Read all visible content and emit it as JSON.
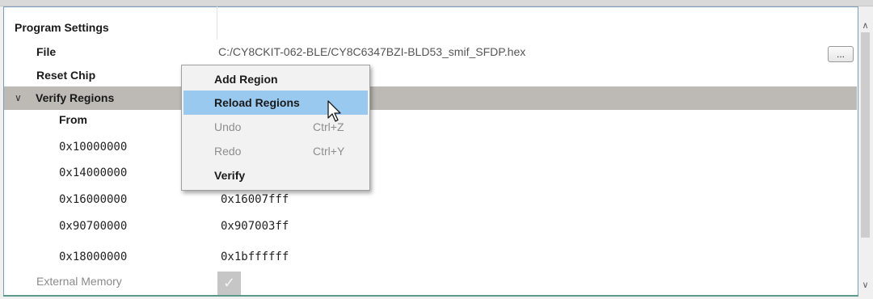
{
  "properties": {
    "program_settings": "Program Settings",
    "file_label": "File",
    "file_value": "C:/CY8CKIT-062-BLE/CY8C6347BZI-BLD53_smif_SFDP.hex",
    "browse_label": "...",
    "reset_chip": "Reset Chip",
    "verify_regions": "Verify Regions",
    "from_header": "From",
    "regions": [
      {
        "from": "0x10000000",
        "to": ""
      },
      {
        "from": "0x14000000",
        "to": ""
      },
      {
        "from": "0x16000000",
        "to": "0x16007fff"
      },
      {
        "from": "0x90700000",
        "to": "0x907003ff"
      },
      {
        "from": "0x18000000",
        "to": "0x1bffffff"
      }
    ],
    "external_memory": "External Memory"
  },
  "context_menu": {
    "items": [
      {
        "label": "Add Region",
        "shortcut": "",
        "state": "enabled"
      },
      {
        "label": "Reload Regions",
        "shortcut": "",
        "state": "highlighted"
      },
      {
        "label": "Undo",
        "shortcut": "Ctrl+Z",
        "state": "disabled"
      },
      {
        "label": "Redo",
        "shortcut": "Ctrl+Y",
        "state": "disabled"
      },
      {
        "label": "Verify",
        "shortcut": "",
        "state": "enabled"
      }
    ]
  },
  "icons": {
    "expander": "chevron-down-icon",
    "checkbox": "check-icon",
    "scroll_up": "arrow-up-icon",
    "scroll_down": "arrow-down-icon",
    "cursor": "mouse-pointer-icon"
  },
  "colors": {
    "selected_row": "#bdb9b4",
    "menu_highlight": "#99c9ef",
    "panel_border": "#7b9cbc"
  }
}
